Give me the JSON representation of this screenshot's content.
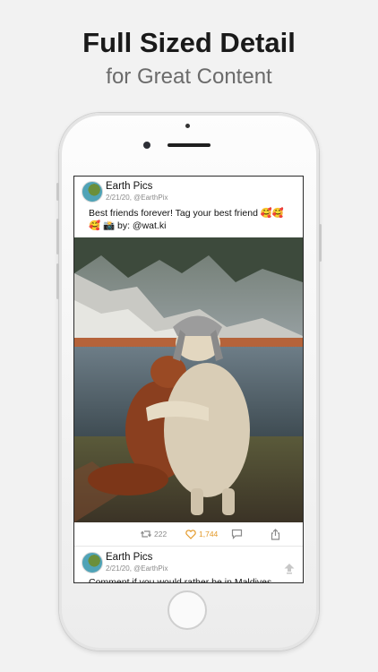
{
  "promo": {
    "headline": "Full Sized Detail",
    "subheadline": "for Great Content"
  },
  "feed": {
    "posts": [
      {
        "author": "Earth Pics",
        "date": "2/21/20",
        "handle": "@EarthPix",
        "meta": "2/21/20, @EarthPix",
        "text": "Best friends forever! Tag your best friend 🥰🥰🥰 📸 by: @wat.ki",
        "image_alt": "Two dogs hugging by a mountain lake",
        "retweets": "222",
        "likes": "1,744"
      },
      {
        "author": "Earth Pics",
        "date": "2/21/20",
        "handle": "@EarthPix",
        "meta": "2/21/20, @EarthPix",
        "text": "Comment if you would rather be in Maldives"
      }
    ]
  },
  "icons": {
    "retweet": "retweet-icon",
    "like": "heart-icon",
    "reply": "comment-icon",
    "share": "share-icon",
    "scroll_top": "scroll-to-top-icon"
  },
  "colors": {
    "like_accent": "#e39a2a",
    "meta_gray": "#8a8a8a",
    "background": "#f2f2f2"
  }
}
